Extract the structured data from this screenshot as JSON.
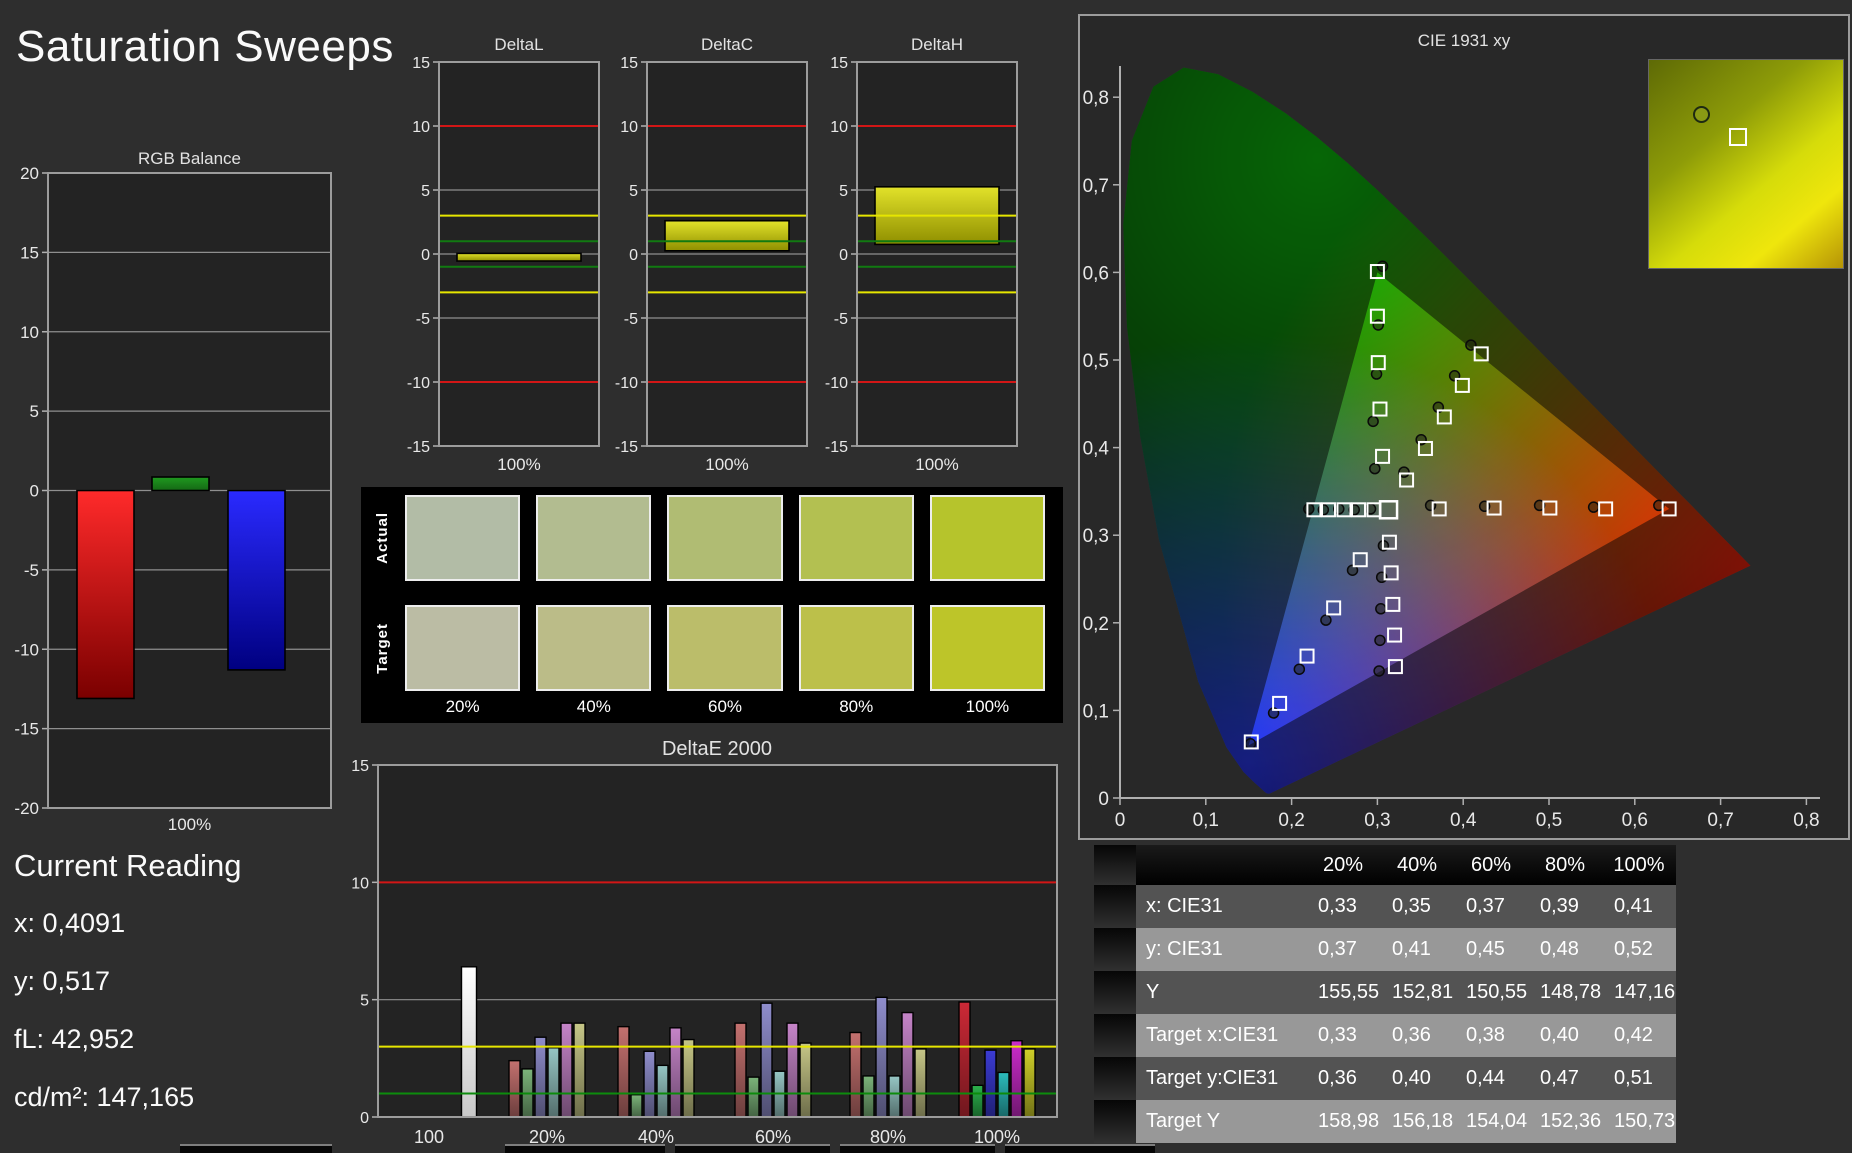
{
  "page": {
    "title": "Saturation Sweeps"
  },
  "current_reading": {
    "title": "Current Reading",
    "lines": [
      {
        "text": "x: 0,4091"
      },
      {
        "text": "y: 0,517"
      },
      {
        "text": "fL: 42,952"
      },
      {
        "text": "cd/m²: 147,165"
      }
    ]
  },
  "swatches": {
    "row_labels": [
      "Actual",
      "Target"
    ],
    "col_labels": [
      "20%",
      "40%",
      "60%",
      "80%",
      "100%"
    ],
    "actual_colors": [
      "#b2bca6",
      "#b2bc90",
      "#b0bc73",
      "#b3c051",
      "#b6c42c"
    ],
    "target_colors": [
      "#bbbca4",
      "#bbbc88",
      "#bbbd6a",
      "#bcc04a",
      "#bdc529"
    ]
  },
  "colors": {
    "limit_red": "#d21616",
    "limit_yellow": "#e6e600",
    "limit_green": "#117a11",
    "deltae_limit_green": "#0c8c0c",
    "bar_red": [
      "#ff2a2a",
      "#7a0000"
    ],
    "bar_green": [
      "#1f9a1f",
      "#156815"
    ],
    "bar_blue": [
      "#2a2aff",
      "#000080"
    ],
    "delta_bar": [
      "#e2e22a",
      "#8f8f00"
    ],
    "deltae_white": [
      "#ffffff",
      "#c8c8c8"
    ],
    "deltae_pastel": [
      "#c4716f",
      "#7cb47a",
      "#8f8dcc",
      "#96c6c4",
      "#c584c8",
      "#c6c687"
    ],
    "deltae_vivid": [
      "#cc2936",
      "#2cb24c",
      "#3b3bd4",
      "#2cbcbc",
      "#cc2ccc",
      "#cfcf29"
    ]
  },
  "chart_data": [
    {
      "id": "rgb_balance",
      "type": "bar",
      "title": "RGB Balance",
      "xlabel": "100%",
      "ylim": [
        -20,
        20
      ],
      "ytick_step": 5,
      "categories": [
        "Red",
        "Green",
        "Blue"
      ],
      "values": [
        -13.1,
        0.85,
        -11.3
      ]
    },
    {
      "id": "delta_l",
      "type": "bar",
      "title": "DeltaL",
      "xlabel": "100%",
      "ylim": [
        -15,
        15
      ],
      "ytick_step": 5,
      "limit_lines": {
        "red": [
          10,
          -10
        ],
        "yellow": [
          3,
          -3
        ],
        "green": [
          1,
          -1
        ]
      },
      "bar": {
        "from": -0.55,
        "to": 0.05
      }
    },
    {
      "id": "delta_c",
      "type": "bar",
      "title": "DeltaC",
      "xlabel": "100%",
      "ylim": [
        -15,
        15
      ],
      "ytick_step": 5,
      "limit_lines": {
        "red": [
          10,
          -10
        ],
        "yellow": [
          3,
          -3
        ],
        "green": [
          1,
          -1
        ]
      },
      "bar": {
        "from": 0.25,
        "to": 2.6
      }
    },
    {
      "id": "delta_h",
      "type": "bar",
      "title": "DeltaH",
      "xlabel": "100%",
      "ylim": [
        -15,
        15
      ],
      "ytick_step": 5,
      "limit_lines": {
        "red": [
          10,
          -10
        ],
        "yellow": [
          3,
          -3
        ],
        "green": [
          1,
          -1
        ]
      },
      "bar": {
        "from": 0.75,
        "to": 5.25
      }
    },
    {
      "id": "deltae_2000",
      "type": "bar",
      "title": "DeltaE 2000",
      "ylim": [
        0,
        15
      ],
      "yticks": [
        0,
        5,
        10,
        15
      ],
      "limit_lines": {
        "red": [
          10
        ],
        "yellow": [
          3
        ],
        "green": [
          1
        ]
      },
      "series_names": [
        "Red",
        "Green",
        "Blue",
        "Cyan",
        "Magenta",
        "Yellow"
      ],
      "groups": [
        {
          "label": "100",
          "style": "white",
          "values": [
            6.4
          ]
        },
        {
          "label": "20%",
          "style": "pastel",
          "values": [
            2.4,
            2.05,
            3.4,
            2.95,
            4.0,
            4.0
          ]
        },
        {
          "label": "40%",
          "style": "pastel",
          "values": [
            3.85,
            0.95,
            2.8,
            2.2,
            3.8,
            3.3
          ]
        },
        {
          "label": "60%",
          "style": "pastel",
          "values": [
            4.0,
            1.7,
            4.85,
            1.95,
            4.0,
            3.15
          ]
        },
        {
          "label": "80%",
          "style": "pastel",
          "values": [
            3.6,
            1.75,
            5.1,
            1.75,
            4.45,
            2.9
          ]
        },
        {
          "label": "100%",
          "style": "vivid",
          "values": [
            4.9,
            1.35,
            2.85,
            1.9,
            3.25,
            2.9
          ]
        }
      ]
    },
    {
      "id": "cie_1931",
      "type": "scatter",
      "title": "CIE 1931 xy",
      "xlim": [
        0,
        0.8
      ],
      "ylim": [
        0,
        0.8
      ],
      "xtick_labels": [
        "0",
        "0,1",
        "0,2",
        "0,3",
        "0,4",
        "0,5",
        "0,6",
        "0,7",
        "0,8"
      ],
      "ytick_labels": [
        "0",
        "0,1",
        "0,2",
        "0,3",
        "0,4",
        "0,5",
        "0,6",
        "0,7",
        "0,8"
      ],
      "white_point": [
        0.313,
        0.329
      ],
      "gamut_triangle": [
        [
          0.64,
          0.33
        ],
        [
          0.3,
          0.6
        ],
        [
          0.15,
          0.06
        ]
      ],
      "sweeps": {
        "red": {
          "targets": [
            [
              0.372,
              0.33
            ],
            [
              0.436,
              0.331
            ],
            [
              0.501,
              0.331
            ],
            [
              0.566,
              0.33
            ],
            [
              0.64,
              0.33
            ]
          ],
          "measured": [
            [
              0.362,
              0.334
            ],
            [
              0.425,
              0.333
            ],
            [
              0.489,
              0.334
            ],
            [
              0.552,
              0.332
            ],
            [
              0.628,
              0.334
            ]
          ]
        },
        "green": {
          "targets": [
            [
              0.306,
              0.39
            ],
            [
              0.303,
              0.444
            ],
            [
              0.301,
              0.497
            ],
            [
              0.3,
              0.55
            ],
            [
              0.3,
              0.601
            ]
          ],
          "measured": [
            [
              0.297,
              0.376
            ],
            [
              0.295,
              0.43
            ],
            [
              0.299,
              0.484
            ],
            [
              0.301,
              0.54
            ],
            [
              0.306,
              0.607
            ]
          ]
        },
        "blue": {
          "targets": [
            [
              0.28,
              0.272
            ],
            [
              0.249,
              0.217
            ],
            [
              0.218,
              0.162
            ],
            [
              0.186,
              0.108
            ],
            [
              0.153,
              0.064
            ]
          ],
          "measured": [
            [
              0.271,
              0.26
            ],
            [
              0.24,
              0.203
            ],
            [
              0.209,
              0.147
            ],
            [
              0.179,
              0.097
            ],
            [
              0.152,
              0.062
            ]
          ]
        },
        "cyan": {
          "targets": [
            [
              0.296,
              0.329
            ],
            [
              0.278,
              0.329
            ],
            [
              0.261,
              0.329
            ],
            [
              0.243,
              0.329
            ],
            [
              0.226,
              0.329
            ]
          ],
          "measured": [
            [
              0.292,
              0.33
            ],
            [
              0.273,
              0.329
            ],
            [
              0.255,
              0.33
            ],
            [
              0.237,
              0.329
            ],
            [
              0.22,
              0.33
            ]
          ]
        },
        "magenta": {
          "targets": [
            [
              0.314,
              0.292
            ],
            [
              0.316,
              0.257
            ],
            [
              0.318,
              0.221
            ],
            [
              0.32,
              0.186
            ],
            [
              0.321,
              0.15
            ]
          ],
          "measured": [
            [
              0.307,
              0.288
            ],
            [
              0.305,
              0.252
            ],
            [
              0.304,
              0.216
            ],
            [
              0.303,
              0.18
            ],
            [
              0.302,
              0.145
            ]
          ]
        },
        "yellow": {
          "targets": [
            [
              0.334,
              0.363
            ],
            [
              0.356,
              0.399
            ],
            [
              0.378,
              0.435
            ],
            [
              0.399,
              0.471
            ],
            [
              0.421,
              0.507
            ]
          ],
          "measured": [
            [
              0.331,
              0.372
            ],
            [
              0.351,
              0.409
            ],
            [
              0.371,
              0.446
            ],
            [
              0.39,
              0.482
            ],
            [
              0.409,
              0.517
            ]
          ]
        }
      },
      "inset_markers": {
        "measured": [
          0.27,
          0.26
        ],
        "target": [
          0.46,
          0.37
        ]
      }
    },
    {
      "id": "sweep_table",
      "type": "table",
      "columns": [
        "20%",
        "40%",
        "60%",
        "80%",
        "100%"
      ],
      "rows": [
        {
          "label": "x: CIE31",
          "values": [
            "0,33",
            "0,35",
            "0,37",
            "0,39",
            "0,41"
          ]
        },
        {
          "label": "y: CIE31",
          "values": [
            "0,37",
            "0,41",
            "0,45",
            "0,48",
            "0,52"
          ]
        },
        {
          "label": "Y",
          "values": [
            "155,55",
            "152,81",
            "150,55",
            "148,78",
            "147,16"
          ]
        },
        {
          "label": "Target x:CIE31",
          "values": [
            "0,33",
            "0,36",
            "0,38",
            "0,40",
            "0,42"
          ]
        },
        {
          "label": "Target y:CIE31",
          "values": [
            "0,36",
            "0,40",
            "0,44",
            "0,47",
            "0,51"
          ]
        },
        {
          "label": "Target Y",
          "values": [
            "158,98",
            "156,18",
            "154,04",
            "152,36",
            "150,73"
          ]
        }
      ]
    }
  ]
}
